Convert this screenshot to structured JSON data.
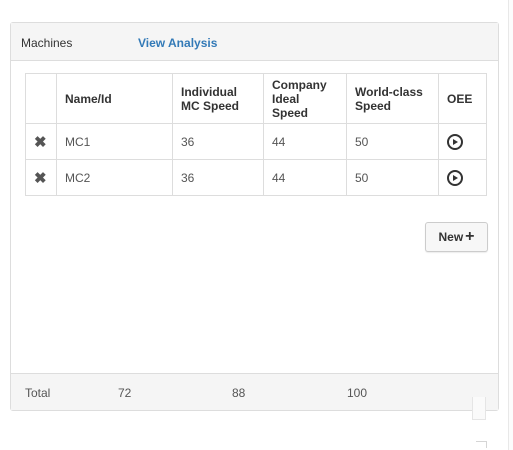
{
  "panel": {
    "heading": {
      "title": "Machines",
      "link": "View Analysis"
    },
    "table": {
      "headers": [
        "",
        "Name/Id",
        "Individual MC Speed",
        "Company Ideal Speed",
        "World-class Speed",
        "OEE"
      ],
      "rows": [
        {
          "delete_icon": "✖",
          "name": "MC1",
          "individual": "36",
          "ideal": "44",
          "world": "50"
        },
        {
          "delete_icon": "✖",
          "name": "MC2",
          "individual": "36",
          "ideal": "44",
          "world": "50"
        }
      ]
    },
    "new_button": {
      "label": "New",
      "icon": "+"
    },
    "footer": {
      "label": "Total",
      "individual": "72",
      "ideal": "88",
      "world": "100"
    }
  },
  "icons": {
    "delete": "close-icon",
    "oee": "play-circle-icon",
    "new": "plus-icon"
  },
  "colors": {
    "link": "#337ab7",
    "heading_bg": "#f5f5f5",
    "border": "#dddddd"
  }
}
